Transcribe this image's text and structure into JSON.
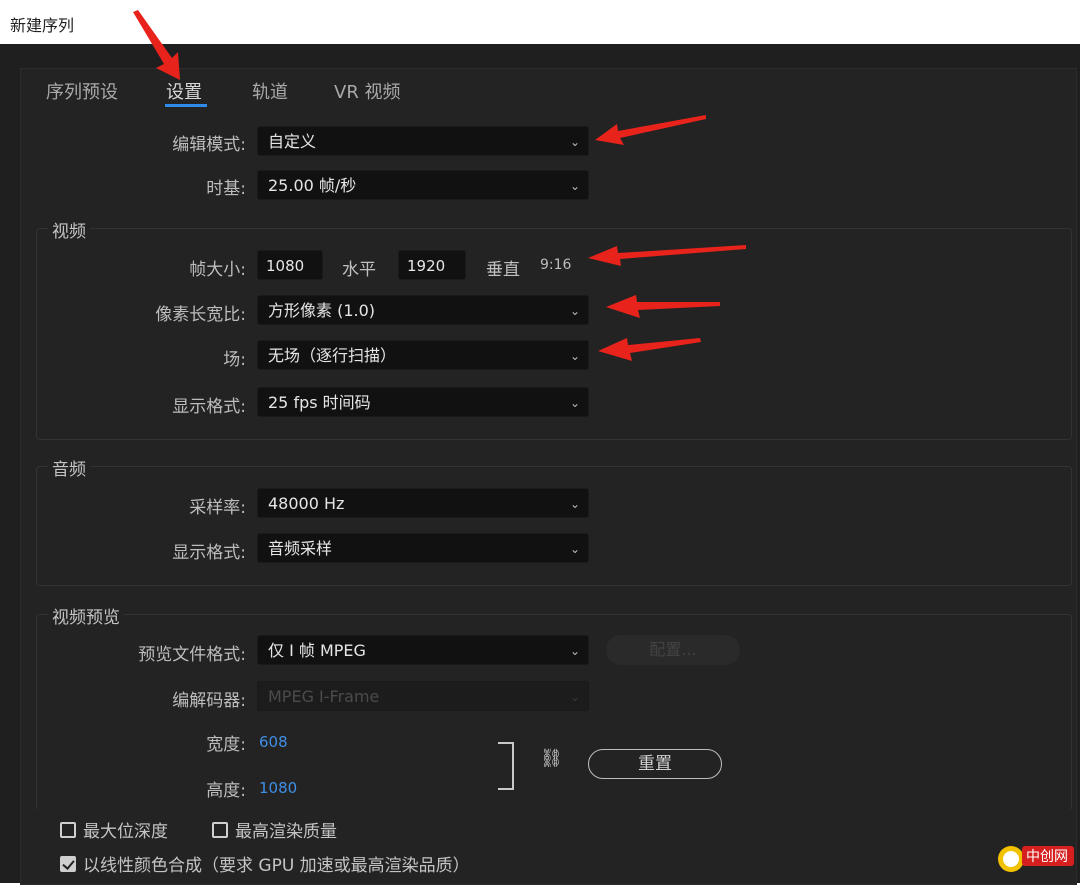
{
  "window": {
    "title": "新建序列"
  },
  "tabs": [
    {
      "label": "序列预设",
      "active": false
    },
    {
      "label": "设置",
      "active": true
    },
    {
      "label": "轨道",
      "active": false
    },
    {
      "label": "VR 视频",
      "active": false
    }
  ],
  "general": {
    "edit_mode_label": "编辑模式:",
    "edit_mode_value": "自定义",
    "timebase_label": "时基:",
    "timebase_value": "25.00 帧/秒"
  },
  "video": {
    "section_title": "视频",
    "frame_size_label": "帧大小:",
    "frame_width": "1080",
    "horizontal_label": "水平",
    "frame_height": "1920",
    "vertical_label": "垂直",
    "aspect": "9:16",
    "pixel_aspect_label": "像素长宽比:",
    "pixel_aspect_value": "方形像素 (1.0)",
    "fields_label": "场:",
    "fields_value": "无场（逐行扫描）",
    "display_format_label": "显示格式:",
    "display_format_value": "25 fps 时间码"
  },
  "audio": {
    "section_title": "音频",
    "sample_rate_label": "采样率:",
    "sample_rate_value": "48000 Hz",
    "display_format_label": "显示格式:",
    "display_format_value": "音频采样"
  },
  "preview": {
    "section_title": "视频预览",
    "file_format_label": "预览文件格式:",
    "file_format_value": "仅 I 帧 MPEG",
    "configure_button": "配置...",
    "codec_label": "编解码器:",
    "codec_value": "MPEG I-Frame",
    "width_label": "宽度:",
    "width_value": "608",
    "height_label": "高度:",
    "height_value": "1080",
    "reset_button": "重置"
  },
  "options": {
    "max_bit_depth": {
      "label": "最大位深度",
      "checked": false
    },
    "max_render_quality": {
      "label": "最高渲染质量",
      "checked": false
    },
    "linear_color": {
      "label": "以线性颜色合成（要求 GPU 加速或最高渲染品质）",
      "checked": true
    }
  },
  "colors": {
    "accent": "#2d8ceb",
    "arrow": "#e8231b",
    "link_value": "#3f8fe6"
  },
  "watermark": {
    "logo_text": "中创网"
  }
}
